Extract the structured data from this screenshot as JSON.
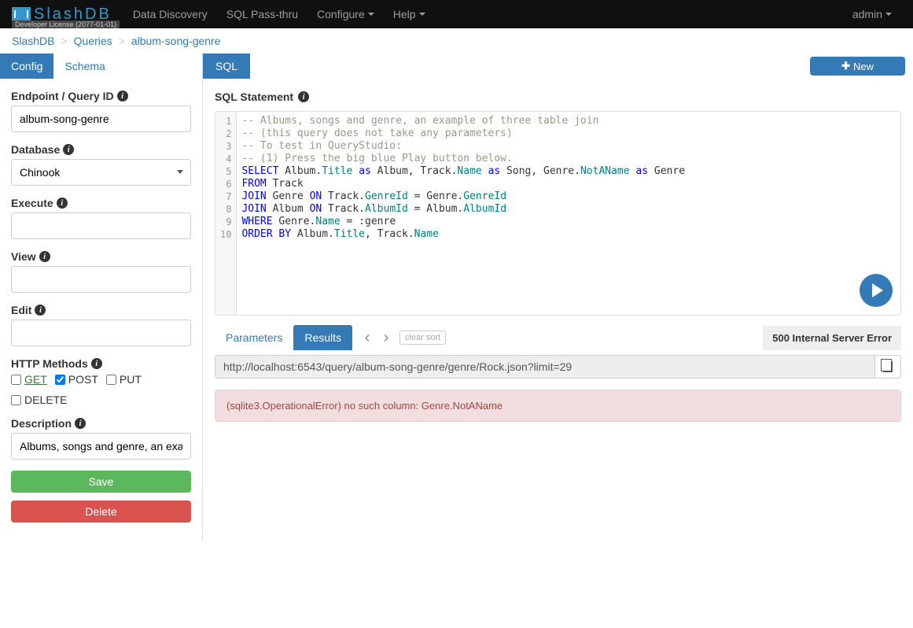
{
  "navbar": {
    "logo_text": "SlashDB",
    "license": "Developer License (2077-01-01)",
    "items": [
      "Data Discovery",
      "SQL Pass-thru",
      "Configure",
      "Help"
    ],
    "user": "admin"
  },
  "breadcrumb": [
    "SlashDB",
    "Queries",
    "album-song-genre"
  ],
  "sidebar": {
    "tabs": [
      "Config",
      "Schema"
    ],
    "endpoint_label": "Endpoint / Query ID",
    "endpoint_value": "album-song-genre",
    "database_label": "Database",
    "database_value": "Chinook",
    "execute_label": "Execute",
    "execute_value": "",
    "view_label": "View",
    "view_value": "",
    "edit_label": "Edit",
    "edit_value": "",
    "http_label": "HTTP Methods",
    "methods": {
      "get": "GET",
      "post": "POST",
      "put": "PUT",
      "delete": "DELETE"
    },
    "description_label": "Description",
    "description_value": "Albums, songs and genre, an example of three table join",
    "save": "Save",
    "delete": "Delete"
  },
  "content": {
    "tabs": [
      "SQL"
    ],
    "new_btn": "New",
    "sql_label": "SQL Statement",
    "line_numbers": [
      "1",
      "2",
      "3",
      "4",
      "5",
      "6",
      "7",
      "8",
      "9",
      "10"
    ],
    "sql_lines": [
      {
        "type": "comment",
        "text": "-- Albums, songs and genre, an example of three table join"
      },
      {
        "type": "comment",
        "text": "-- (this query does not take any parameters)"
      },
      {
        "type": "comment",
        "text": "-- To test in QueryStudio:"
      },
      {
        "type": "comment",
        "text": "-- (1) Press the big blue Play button below."
      },
      {
        "type": "select",
        "tokens": [
          [
            "kw",
            "SELECT"
          ],
          [
            "",
            " Album."
          ],
          [
            "prop",
            "Title"
          ],
          [
            "",
            " "
          ],
          [
            "kw",
            "as"
          ],
          [
            "",
            " Album, Track."
          ],
          [
            "prop",
            "Name"
          ],
          [
            "",
            " "
          ],
          [
            "kw",
            "as"
          ],
          [
            "",
            " Song, Genre."
          ],
          [
            "prop",
            "NotAName"
          ],
          [
            "",
            " "
          ],
          [
            "kw",
            "as"
          ],
          [
            "",
            " Genre"
          ]
        ]
      },
      {
        "type": "from",
        "tokens": [
          [
            "kw",
            "FROM"
          ],
          [
            "",
            " Track"
          ]
        ]
      },
      {
        "type": "join",
        "tokens": [
          [
            "kw",
            "JOIN"
          ],
          [
            "",
            " Genre "
          ],
          [
            "kw",
            "ON"
          ],
          [
            "",
            " Track."
          ],
          [
            "prop",
            "GenreId"
          ],
          [
            "",
            " = Genre."
          ],
          [
            "prop",
            "GenreId"
          ]
        ]
      },
      {
        "type": "join",
        "tokens": [
          [
            "kw",
            "JOIN"
          ],
          [
            "",
            " Album "
          ],
          [
            "kw",
            "ON"
          ],
          [
            "",
            " Track."
          ],
          [
            "prop",
            "AlbumId"
          ],
          [
            "",
            " = Album."
          ],
          [
            "prop",
            "AlbumId"
          ]
        ]
      },
      {
        "type": "where",
        "tokens": [
          [
            "kw",
            "WHERE"
          ],
          [
            "",
            " Genre."
          ],
          [
            "prop",
            "Name"
          ],
          [
            "",
            " = :genre"
          ]
        ]
      },
      {
        "type": "order",
        "tokens": [
          [
            "kw",
            "ORDER"
          ],
          [
            "",
            " "
          ],
          [
            "kw",
            "BY"
          ],
          [
            "",
            " Album."
          ],
          [
            "prop",
            "Title"
          ],
          [
            "",
            ", Track."
          ],
          [
            "prop",
            "Name"
          ]
        ]
      }
    ],
    "result_tabs": [
      "Parameters",
      "Results"
    ],
    "clear_sort": "clear sort",
    "status": "500 Internal Server Error",
    "url": "http://localhost:6543/query/album-song-genre/genre/Rock.json?limit=29",
    "error": "(sqlite3.OperationalError) no such column: Genre.NotAName"
  }
}
